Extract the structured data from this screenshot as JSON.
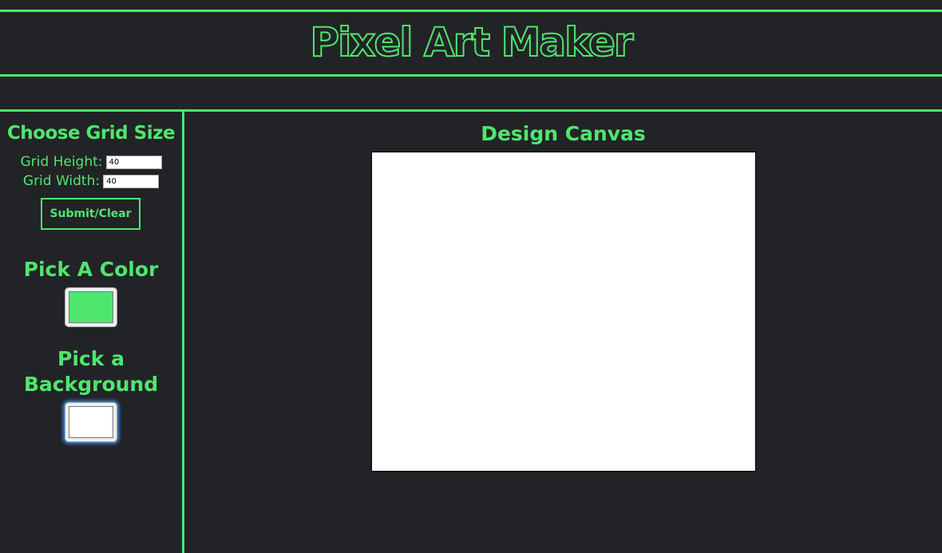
{
  "header": {
    "title": "Pixel Art Maker"
  },
  "sidebar": {
    "grid_heading": "Choose Grid Size",
    "grid_height_label": "Grid Height:",
    "grid_height_value": "40",
    "grid_width_label": "Grid Width:",
    "grid_width_value": "40",
    "submit_label": "Submit/Clear",
    "color_heading": "Pick A Color",
    "color_value": "#4ee66e",
    "background_heading": "Pick a Background",
    "background_value": "#ffffff"
  },
  "main": {
    "canvas_heading": "Design Canvas"
  },
  "colors": {
    "accent": "#4ee66e",
    "page_background": "#222326",
    "canvas_background": "#ffffff"
  }
}
